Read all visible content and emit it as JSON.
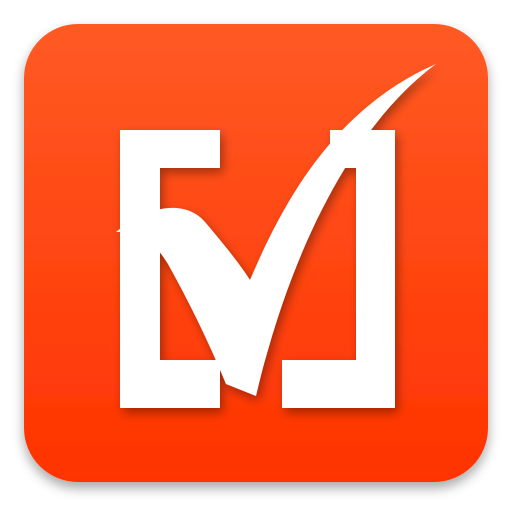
{
  "icon": {
    "name": "checkbox-checked-app-icon",
    "colors": {
      "background_top": "#ff5a24",
      "background_bottom": "#ff3300",
      "glyph": "#ffffff",
      "edge_shadow": "#b32a00"
    }
  }
}
